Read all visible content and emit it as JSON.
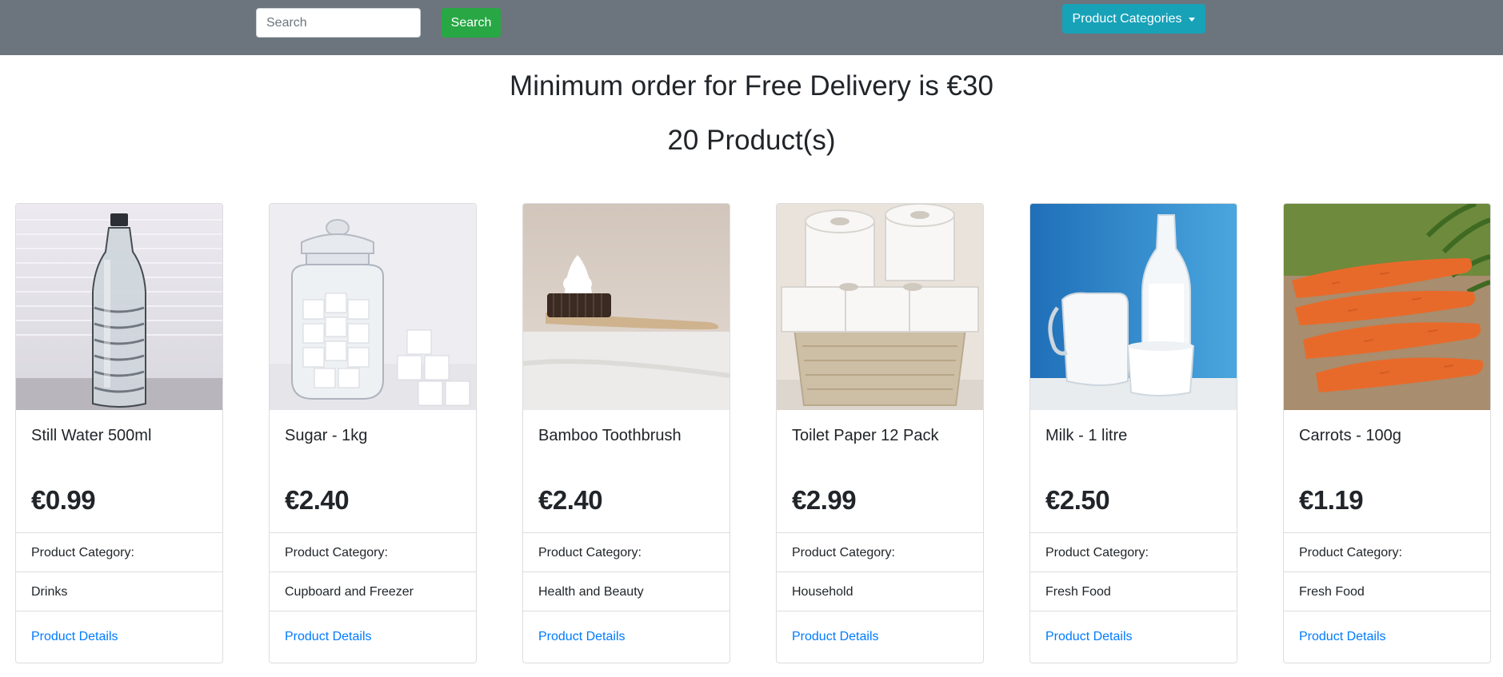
{
  "navbar": {
    "search_placeholder": "Search",
    "search_button": "Search",
    "categories_button": "Product Categories"
  },
  "banner": {
    "delivery_notice": "Minimum order for Free Delivery is €30",
    "product_count": "20 Product(s)"
  },
  "products": [
    {
      "name": "Still Water 500ml",
      "price": "€0.99",
      "category_label": "Product Category:",
      "category": "Drinks",
      "details_link": "Product Details"
    },
    {
      "name": "Sugar - 1kg",
      "price": "€2.40",
      "category_label": "Product Category:",
      "category": "Cupboard and Freezer",
      "details_link": "Product Details"
    },
    {
      "name": "Bamboo Toothbrush",
      "price": "€2.40",
      "category_label": "Product Category:",
      "category": "Health and Beauty",
      "details_link": "Product Details"
    },
    {
      "name": "Toilet Paper 12 Pack",
      "price": "€2.99",
      "category_label": "Product Category:",
      "category": "Household",
      "details_link": "Product Details"
    },
    {
      "name": "Milk - 1 litre",
      "price": "€2.50",
      "category_label": "Product Category:",
      "category": "Fresh Food",
      "details_link": "Product Details"
    },
    {
      "name": "Carrots - 100g",
      "price": "€1.19",
      "category_label": "Product Category:",
      "category": "Fresh Food",
      "details_link": "Product Details"
    }
  ],
  "colors": {
    "navbar_bg": "#6c757d",
    "search_button_bg": "#28a745",
    "categories_button_bg": "#17a2b8",
    "link": "#007bff"
  },
  "icons": {
    "categories_dropdown": "caret-down-icon"
  }
}
